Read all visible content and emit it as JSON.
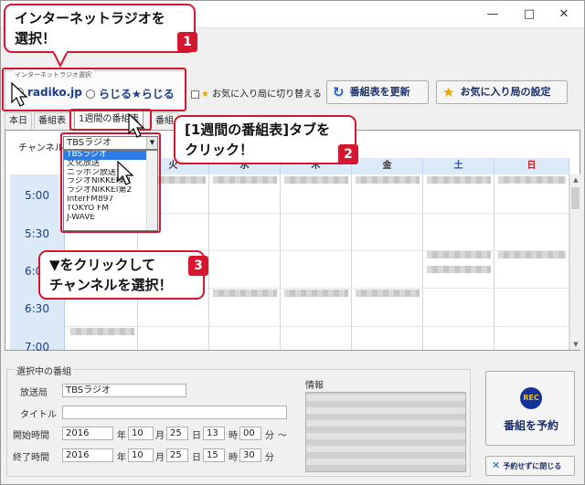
{
  "window": {
    "minimize": "—",
    "maximize": "□",
    "close": "✕"
  },
  "radio_group": {
    "legend": "インターネットラジオ選択",
    "option1": "radiko.jp",
    "option2": "らじる★らじる"
  },
  "fav_checkbox_label": "お気に入り局に切り替える",
  "buttons": {
    "refresh": "番組表を更新",
    "fav_settings": "お気に入り局の設定"
  },
  "tabs": [
    "本日",
    "番組表",
    "1週間の番組表",
    "番組"
  ],
  "channel_label": "チャンネル",
  "combo": {
    "selected": "TBSラジオ",
    "options": [
      "TBSラジオ",
      "文化放送",
      "ニッポン放送",
      "ラジオNIKKEI第1",
      "ラジオNIKKEI第2",
      "InterFM897",
      "TOKYO FM",
      "J-WAVE"
    ]
  },
  "days": [
    "火",
    "水",
    "木",
    "金",
    "土",
    "日"
  ],
  "times": [
    "5:00",
    "5:30",
    "6:00",
    "6:30",
    "7:00"
  ],
  "selected_program": {
    "group_title": "選択中の番組",
    "station_label": "放送局",
    "station_value": "TBSラジオ",
    "title_label": "タイトル",
    "start_label": "開始時間",
    "end_label": "終了時間",
    "year": "2016",
    "year_unit": "年",
    "month": "10",
    "month_unit": "月",
    "day": "25",
    "day_unit": "日",
    "start_hour": "13",
    "start_min": "00",
    "end_hour": "15",
    "end_min": "30",
    "hour_unit": "時",
    "min_unit": "分",
    "tilde": "～",
    "info_label": "情報"
  },
  "rec_button": {
    "icon_text": "REC",
    "label": "番組を予約"
  },
  "close_button": "予約せずに閉じる",
  "callouts": {
    "c1_line1": "インターネットラジオを",
    "c1_line2": "選択！",
    "c1_num": "1",
    "c2_line1": "[1週間の番組表]タブを",
    "c2_line2": "クリック！",
    "c2_num": "2",
    "c3_line1": "▼をクリックして",
    "c3_line2": "チャンネルを選択！",
    "c3_num": "3"
  },
  "colors": {
    "accent": "#d6162f",
    "header": "#dce9f9",
    "saturday": "#1b56c9",
    "sunday": "#d11f1f"
  }
}
